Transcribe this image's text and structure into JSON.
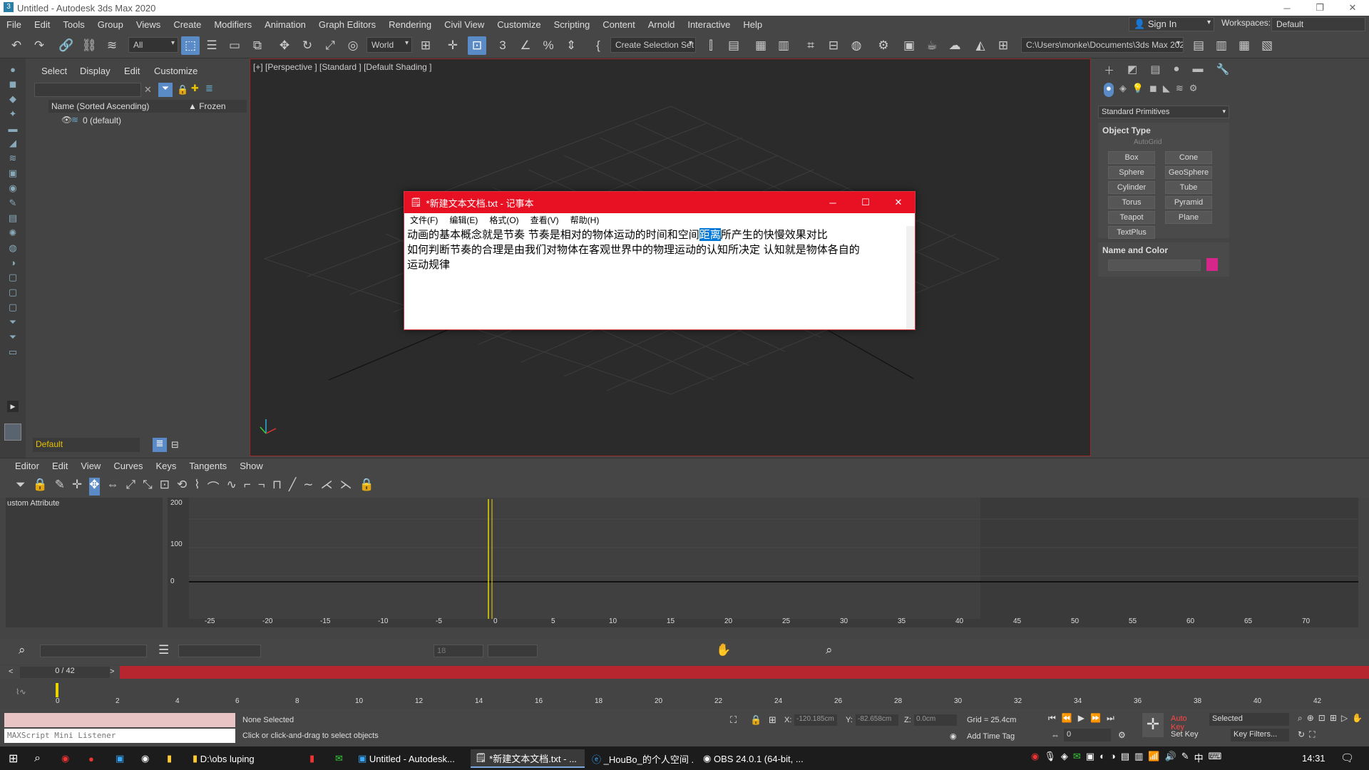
{
  "window": {
    "title": "Untitled - Autodesk 3ds Max 2020"
  },
  "menubar": {
    "items": [
      "File",
      "Edit",
      "Tools",
      "Group",
      "Views",
      "Create",
      "Modifiers",
      "Animation",
      "Graph Editors",
      "Rendering",
      "Civil View",
      "Customize",
      "Scripting",
      "Content",
      "Arnold",
      "Interactive",
      "Help"
    ],
    "signin": "Sign In",
    "workspaces_label": "Workspaces:",
    "workspace": "Default"
  },
  "toolbar": {
    "filter": "All",
    "refcoord": "World",
    "selset": "Create Selection Set",
    "path": "C:\\Users\\monke\\Documents\\3ds Max 2020"
  },
  "scene_explorer": {
    "tabs": [
      "Select",
      "Display",
      "Edit",
      "Customize"
    ],
    "col_name": "Name (Sorted Ascending)",
    "col_frozen": "▲ Frozen",
    "layer": "0 (default)",
    "layer_dropdown": "Default"
  },
  "viewport": {
    "label": "[+] [Perspective ] [Standard ] [Default Shading ]"
  },
  "command_panel": {
    "category": "Standard Primitives",
    "object_type": "Object Type",
    "autogrid": "AutoGrid",
    "buttons": [
      "Box",
      "Cone",
      "Sphere",
      "GeoSphere",
      "Cylinder",
      "Tube",
      "Torus",
      "Pyramid",
      "Teapot",
      "Plane",
      "TextPlus"
    ],
    "name_and_color": "Name and Color",
    "object_color": "#d6268a"
  },
  "notepad": {
    "title": "*新建文本文档.txt - 记事本",
    "menu": [
      "文件(F)",
      "编辑(E)",
      "格式(O)",
      "查看(V)",
      "帮助(H)"
    ],
    "line1_a": "动画的基本概念就是节奏       节奏是相对的物体运动的时间和空间",
    "line1_sel": "距离",
    "line1_b": "所产生的快慢效果对比",
    "line2": "如何判断节奏的合理是由我们对物体在客观世界中的物理运动的认知所决定     认知就是物体各自的",
    "line3": "运动规律"
  },
  "curve_editor": {
    "menu": [
      "Editor",
      "Edit",
      "View",
      "Curves",
      "Keys",
      "Tangents",
      "Show"
    ],
    "left_label": "ustom Attribute",
    "y_ticks": [
      "200",
      "100",
      "0"
    ],
    "x_ticks": [
      "-25",
      "-20",
      "-15",
      "-10",
      "-5",
      "0",
      "5",
      "10",
      "15",
      "20",
      "25",
      "30",
      "35",
      "40",
      "45",
      "50",
      "55",
      "60",
      "65",
      "70"
    ],
    "frame_field": "18"
  },
  "timeline": {
    "frame": "0 / 42",
    "ticks": [
      "0",
      "2",
      "4",
      "6",
      "8",
      "10",
      "12",
      "14",
      "16",
      "18",
      "20",
      "22",
      "24",
      "26",
      "28",
      "30",
      "32",
      "34",
      "36",
      "38",
      "40",
      "42"
    ]
  },
  "status": {
    "listener": "MAXScript Mini Listener",
    "selection": "None Selected",
    "prompt": "Click or click-and-drag to select objects",
    "x_label": "X:",
    "x": "-120.185cm",
    "y_label": "Y:",
    "y": "-82.658cm",
    "z_label": "Z:",
    "z": "0.0cm",
    "grid": "Grid = 25.4cm",
    "addtimetag": "Add Time Tag",
    "autokey": "Auto Key",
    "selected": "Selected",
    "setkey": "Set Key",
    "keyfilters": "Key Filters...",
    "frame_spinner": "0"
  },
  "taskbar": {
    "tasks": [
      "D:\\obs luping",
      "Untitled - Autodesk...",
      "*新建文本文档.txt - ...",
      "_HouBo_的个人空间 ...",
      "OBS 24.0.1 (64-bit, ..."
    ],
    "ime": "中",
    "time": "14:31"
  }
}
